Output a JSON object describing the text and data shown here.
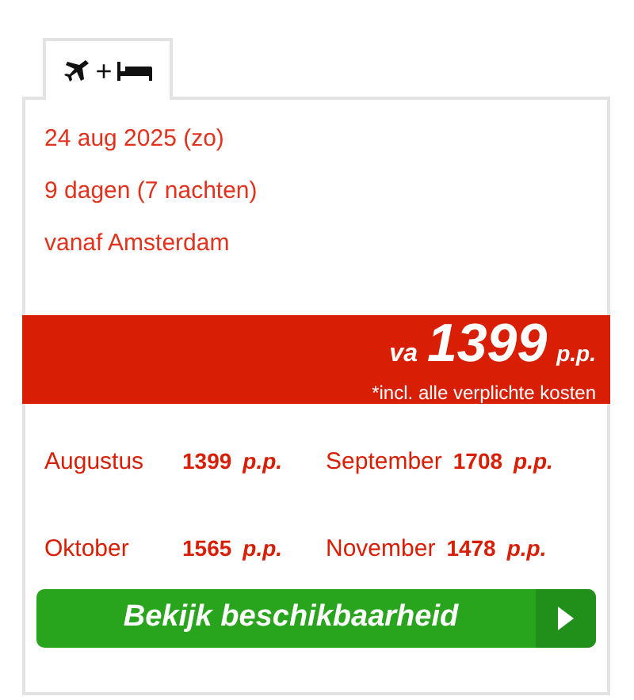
{
  "tabs": [
    {
      "plus": "+",
      "selected": true
    }
  ],
  "details": [
    "24 aug 2025 (zo)",
    "9 dagen (7 nachten)",
    "vanaf Amsterdam"
  ],
  "price_banner": {
    "prefix": "va",
    "price": "1399",
    "unit": "p.p.",
    "note": "*incl. alle verplichte kosten"
  },
  "months": [
    {
      "month": "Augustus",
      "price": "1399",
      "unit": "p.p."
    },
    {
      "month": "September",
      "price": "1708",
      "unit": "p.p."
    },
    {
      "month": "Oktober",
      "price": "1565",
      "unit": "p.p."
    },
    {
      "month": "November",
      "price": "1478",
      "unit": "p.p."
    }
  ],
  "button": {
    "label": "Bekijk beschikbaarheid"
  }
}
